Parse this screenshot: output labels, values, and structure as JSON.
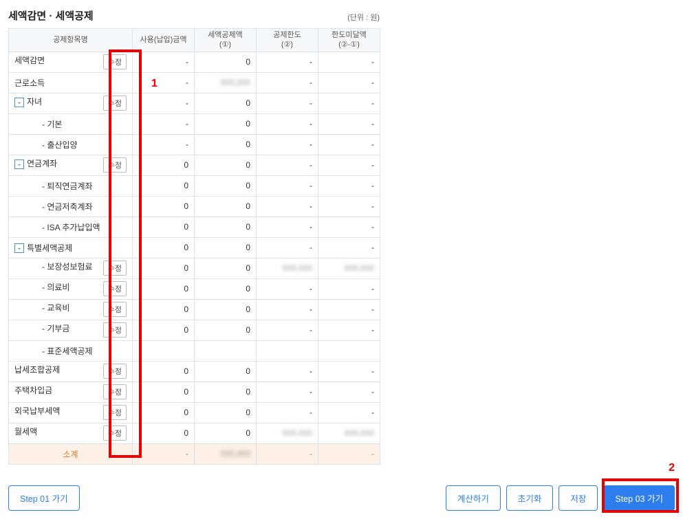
{
  "header": {
    "title": "세액감면 · 세액공제",
    "unit": "(단위 : 원)"
  },
  "table": {
    "headers": {
      "name": "공제항목명",
      "col1": "사용(납입)금액",
      "col2_l1": "세액공제액",
      "col2_l2": "(①)",
      "col3_l1": "공제한도",
      "col3_l2": "(②)",
      "col4_l1": "한도미달액",
      "col4_l2": "(②-①)"
    },
    "edit_label": "수정",
    "subtotal_label": "소계"
  },
  "rows": [
    {
      "name": "세액감면",
      "edit": true,
      "c1": "-",
      "c2": "0",
      "c3": "-",
      "c4": "-",
      "indent": 0
    },
    {
      "name": "근로소득",
      "edit": false,
      "c1": "-",
      "c2": "",
      "c2_blur": true,
      "c3": "-",
      "c4": "-",
      "indent": 0
    },
    {
      "name": "자녀",
      "toggle": true,
      "edit": true,
      "c1": "-",
      "c2": "0",
      "c3": "-",
      "c4": "-",
      "indent": 0
    },
    {
      "name": "- 기본",
      "edit": false,
      "c1": "-",
      "c2": "0",
      "c3": "-",
      "c4": "-",
      "indent": 2
    },
    {
      "name": "- 출산입양",
      "edit": false,
      "c1": "-",
      "c2": "0",
      "c3": "-",
      "c4": "-",
      "indent": 2
    },
    {
      "name": "연금계좌",
      "toggle": true,
      "edit": true,
      "c1": "0",
      "c2": "0",
      "c3": "-",
      "c4": "-",
      "indent": 0
    },
    {
      "name": "- 퇴직연금계좌",
      "edit": false,
      "c1": "0",
      "c2": "0",
      "c3": "-",
      "c4": "-",
      "indent": 2
    },
    {
      "name": "- 연금저축계좌",
      "edit": false,
      "c1": "0",
      "c2": "0",
      "c3": "-",
      "c4": "-",
      "indent": 2
    },
    {
      "name": "- ISA 추가납입액",
      "edit": false,
      "c1": "0",
      "c2": "0",
      "c3": "-",
      "c4": "-",
      "indent": 2
    },
    {
      "name": "특별세액공제",
      "toggle": true,
      "edit": false,
      "c1": "0",
      "c2": "0",
      "c3": "-",
      "c4": "-",
      "indent": 0
    },
    {
      "name": "- 보장성보험료",
      "edit": true,
      "c1": "0",
      "c2": "0",
      "c3": "",
      "c3_blur": true,
      "c4": "",
      "c4_blur": true,
      "indent": 2
    },
    {
      "name": "- 의료비",
      "edit": true,
      "c1": "0",
      "c2": "0",
      "c3": "-",
      "c4": "-",
      "indent": 2
    },
    {
      "name": "- 교육비",
      "edit": true,
      "c1": "0",
      "c2": "0",
      "c3": "-",
      "c4": "-",
      "indent": 2
    },
    {
      "name": "- 기부금",
      "edit": true,
      "c1": "0",
      "c2": "0",
      "c3": "-",
      "c4": "-",
      "indent": 2
    },
    {
      "name": "- 표준세액공제",
      "edit": false,
      "c1": "",
      "c2": "",
      "c3": "",
      "c4": "",
      "indent": 2
    },
    {
      "name": "납세조합공제",
      "edit": true,
      "c1": "0",
      "c2": "0",
      "c3": "-",
      "c4": "-",
      "indent": 0
    },
    {
      "name": "주택차입금",
      "edit": true,
      "c1": "0",
      "c2": "0",
      "c3": "-",
      "c4": "-",
      "indent": 0
    },
    {
      "name": "외국납부세액",
      "edit": true,
      "c1": "0",
      "c2": "0",
      "c3": "-",
      "c4": "-",
      "indent": 0
    },
    {
      "name": "월세액",
      "edit": true,
      "c1": "0",
      "c2": "0",
      "c3": "",
      "c3_blur": true,
      "c4": "",
      "c4_blur": true,
      "indent": 0
    }
  ],
  "subtotal": {
    "c1": "-",
    "c2": "",
    "c2_blur": true,
    "c3": "-",
    "c4": "-"
  },
  "footer": {
    "step01": "Step 01 가기",
    "calc": "계산하기",
    "reset": "초기화",
    "save": "저장",
    "step03": "Step 03 가기"
  },
  "annotations": {
    "label1": "1",
    "label2": "2"
  }
}
